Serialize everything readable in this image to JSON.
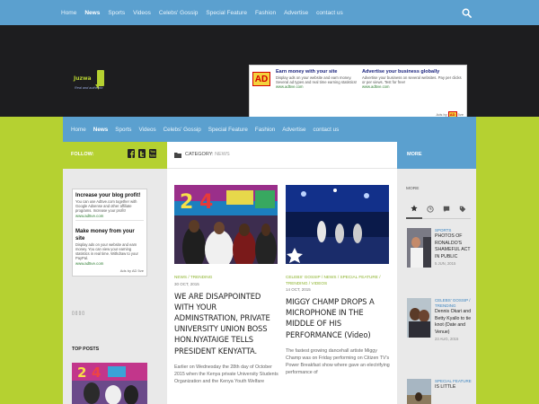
{
  "top_nav": {
    "items": [
      "Home",
      "News",
      "Sports",
      "Videos",
      "Celebs' Gossip",
      "Special Feature",
      "Fashion",
      "Advertise",
      "contact us"
    ],
    "active": "News"
  },
  "logo": {
    "word": "Juzwa",
    "tagline": "Real and authentic"
  },
  "header_ad": {
    "badge": "AD",
    "col1": {
      "title": "Earn money with your site",
      "text": "Display ads on your website and earn money. Several ad types and real time earning statistics! ",
      "url": "www.ad5ve.com"
    },
    "col2": {
      "title": "Advertise your business globally",
      "text": "Advertise your business on several websites. Pay per clicks or per views. Test for free!",
      "url": "www.ad5ve.com"
    },
    "ads_by_prefix": "Ads by",
    "ads_by_brand": "AD",
    "ads_by_suffix": "5ve"
  },
  "nav2": {
    "items": [
      "Home",
      "News",
      "Sports",
      "Videos",
      "Celebs' Gossip",
      "Special Feature",
      "Fashion",
      "Advertise",
      "contact us"
    ],
    "active": "News"
  },
  "left_sidebar": {
    "follow_label": "FOLLOW:",
    "ad1": {
      "heading": "Increase your blog profit!",
      "text": "You can use Ad5ve.com together with Google Adsense and other affiliate programs. Increase your profit!",
      "url": "www.ad5ve.com"
    },
    "ad2": {
      "heading": "Make money from your site",
      "text": "Display ads on your website and earn money. You can view your earning statistics in real time. Withdraw to your PayPal.",
      "url": "www.ad5ve.com"
    },
    "ads_by": "Ads by AD 5ve",
    "dots": "▯▯▯▯",
    "top_posts_label": "TOP POSTS"
  },
  "category_bar": {
    "label": "CATEGORY:",
    "value": "NEWS"
  },
  "posts": [
    {
      "categories": "NEWS / TRENDING",
      "date": "30 OCT, 2015",
      "title": "WE ARE DISAPPOINTED WITH YOUR ADMINSTRATION, PRIVATE UNIVERSITY UNION BOSS HON.NYATAIGE TELLS PRESIDENT KENYATTA.",
      "excerpt": "Earlier on Wednesday the 28th day of October 2015 when the Kenya private University Students Organization and the Kenya Youth Welfare"
    },
    {
      "categories": "CELEBS' GOSSIP / NEWS / SPECIAL FEATURE / TRENDING / VIDEOS",
      "date": "14 OCT, 2015",
      "title": "MIGGY CHAMP DROPS A MICROPHONE IN THE MIDDLE OF HIS PERFORMANCE (Video)",
      "excerpt": "The fastest growing dancehall artiste Miggy Champ was on Friday performing on Citizen TV's Power Breakfast show where gave an electrifying performance of"
    }
  ],
  "right_sidebar": {
    "header": "MORE",
    "more_label": "MORE",
    "tabs": [
      "star-icon",
      "clock-icon",
      "comment-icon",
      "tag-icon"
    ],
    "posts": [
      {
        "category": "SPORTS",
        "title": "PHOTOS OF RONALDO'S SHAMEFUL ACT IN PUBLIC",
        "date": "5 JUN, 2015"
      },
      {
        "category": "CELEBS' GOSSIP / TRENDING",
        "title": "Dennis Okari and Betty Kyallo to tie knot (Date and Venue)",
        "date": "23 AUG, 2015"
      },
      {
        "category": "SPECIAL FEATURE",
        "title": "IS LITTLE",
        "date": ""
      }
    ]
  },
  "colors": {
    "accent_blue": "#5ba0cf",
    "accent_green": "#b5d131",
    "header_dark": "#1d1d1f"
  }
}
